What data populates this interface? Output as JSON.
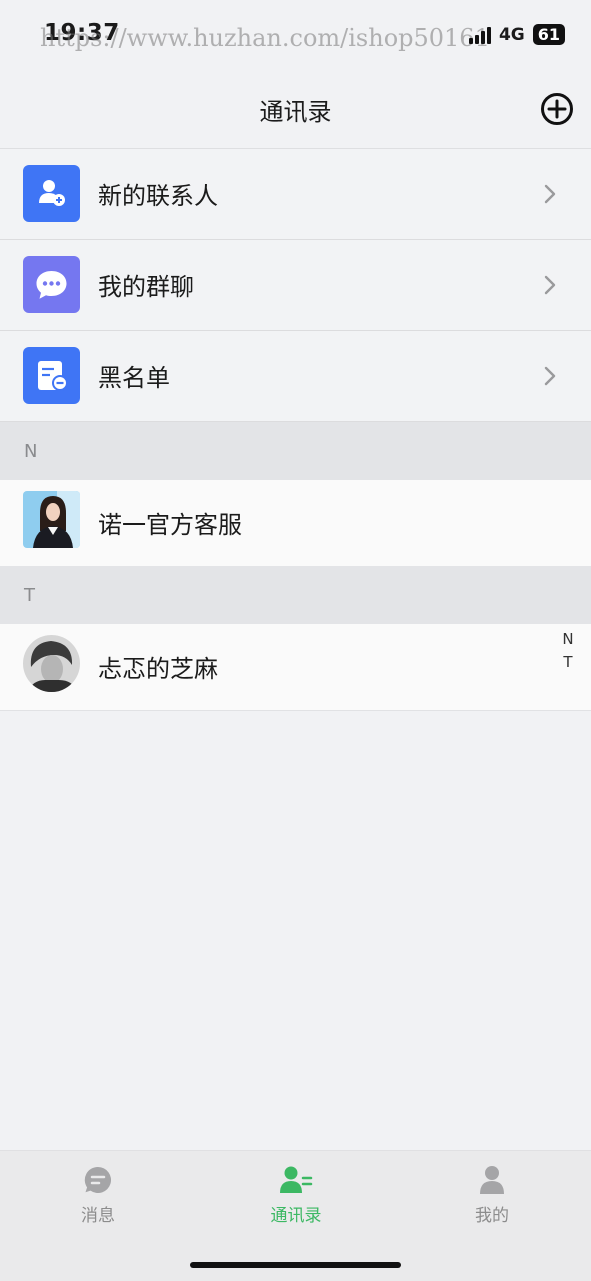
{
  "status_bar": {
    "time": "19:37",
    "watermark": "https://www.huzhan.com/ishop50161",
    "network": "4G",
    "battery": "61"
  },
  "nav": {
    "title": "通讯录",
    "add_icon": "plus-circle-icon"
  },
  "menu": [
    {
      "label": "新的联系人",
      "icon": "add-contact-icon",
      "color": "#3f75f5"
    },
    {
      "label": "我的群聊",
      "icon": "chat-bubble-icon",
      "color": "#7577f0"
    },
    {
      "label": "黑名单",
      "icon": "blacklist-icon",
      "color": "#3f75f5"
    }
  ],
  "sections": [
    {
      "letter": "N",
      "contacts": [
        {
          "name": "诺一官方客服",
          "avatar": "customer-service-avatar"
        }
      ]
    },
    {
      "letter": "T",
      "contacts": [
        {
          "name": "忐忑的芝麻",
          "avatar": "user-avatar"
        }
      ]
    }
  ],
  "index": [
    "N",
    "T"
  ],
  "tabs": [
    {
      "label": "消息",
      "icon": "message-icon",
      "active": false
    },
    {
      "label": "通讯录",
      "icon": "contacts-icon",
      "active": true
    },
    {
      "label": "我的",
      "icon": "profile-icon",
      "active": false
    }
  ],
  "colors": {
    "accent": "#3cb863",
    "inactive": "#8c8c8c",
    "blue": "#3f75f5",
    "purple": "#7577f0"
  }
}
